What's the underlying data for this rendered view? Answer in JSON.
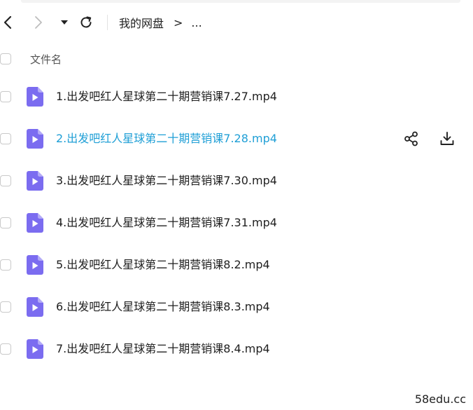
{
  "toolbar": {
    "back_icon": "chevron-left-icon",
    "forward_icon": "chevron-right-icon",
    "dropdown_icon": "caret-down-icon",
    "refresh_icon": "refresh-icon"
  },
  "breadcrumb": {
    "root": "我的网盘",
    "separator": ">",
    "ellipsis": "..."
  },
  "list_header": {
    "name_column": "文件名"
  },
  "files": [
    {
      "name": "1.出发吧红人星球第二十期营销课7.27.mp4"
    },
    {
      "name": "2.出发吧红人星球第二十期营销课7.28.mp4",
      "hovered": true
    },
    {
      "name": "3.出发吧红人星球第二十期营销课7.30.mp4"
    },
    {
      "name": "4.出发吧红人星球第二十期营销课7.31.mp4"
    },
    {
      "name": "5.出发吧红人星球第二十期营销课8.2.mp4"
    },
    {
      "name": "6.出发吧红人星球第二十期营销课8.3.mp4"
    },
    {
      "name": "7.出发吧红人星球第二十期营销课8.4.mp4"
    }
  ],
  "row_actions": {
    "share_icon": "share-icon",
    "download_icon": "download-icon"
  },
  "colors": {
    "accent": "#1f9fd6",
    "video_icon": "#7b6cf0"
  },
  "watermark": "58edu.cc"
}
